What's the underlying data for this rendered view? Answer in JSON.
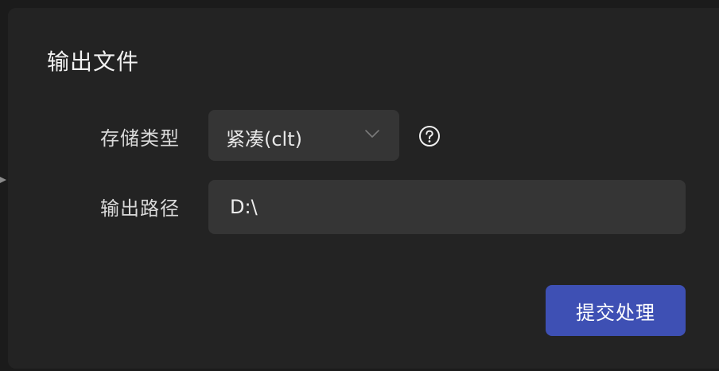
{
  "dialog": {
    "title": "输出文件"
  },
  "form": {
    "storage_type": {
      "label": "存储类型",
      "selected": "紧凑(clt)"
    },
    "output_path": {
      "label": "输出路径",
      "value": "D:\\"
    }
  },
  "actions": {
    "submit_label": "提交处理"
  },
  "icons": {
    "dropdown": "chevron-down-icon",
    "help": "help-icon"
  },
  "colors": {
    "background": "#1b1b1b",
    "panel": "#232323",
    "field": "#353535",
    "accent": "#3e50b4",
    "text": "#e8e8e8"
  }
}
